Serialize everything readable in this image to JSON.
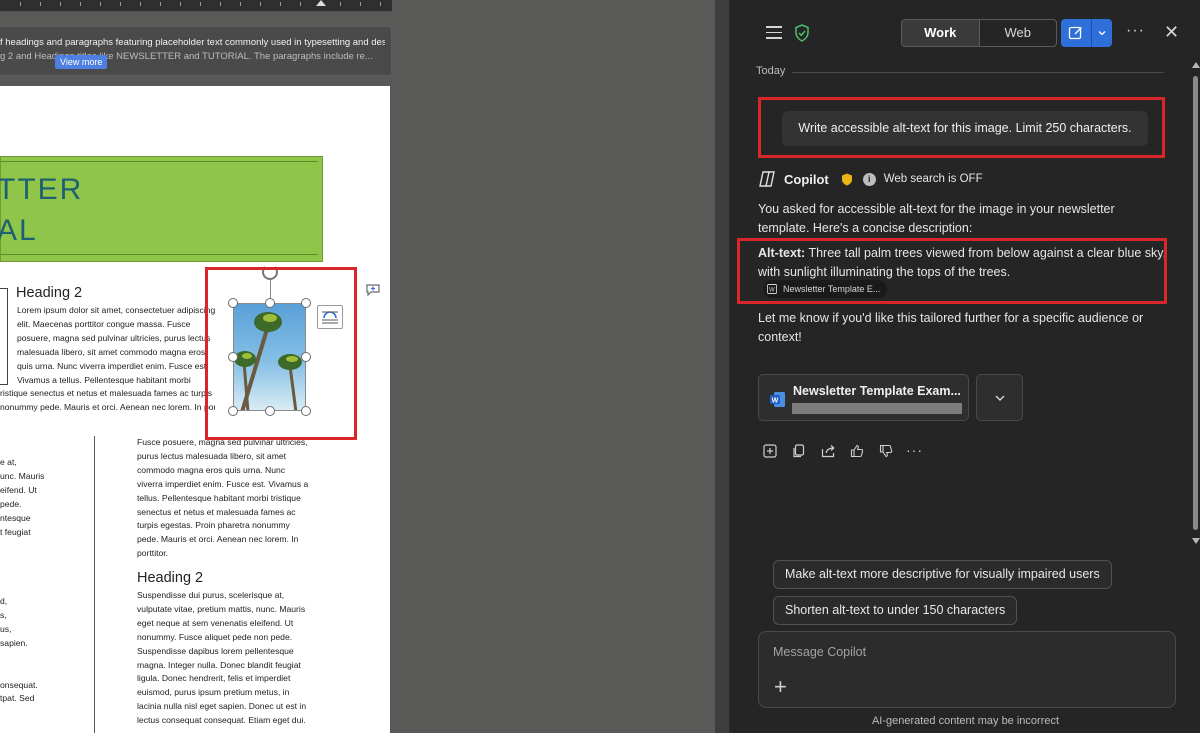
{
  "document": {
    "summary_line1": "f headings and paragraphs featuring placeholder text commonly used in typesetting and design,",
    "summary_line2": "g 2 and Headings titles like NEWSLETTER and TUTORIAL. The paragraphs include re...",
    "view_more": "View more",
    "banner_line1": "TTER",
    "banner_line2": "AL",
    "heading_a": "Heading 2",
    "heading_b": "Heading 2",
    "para_a": [
      "Lorem ipsum dolor sit amet, consectetuer adipiscing",
      "elit.  Maecenas porttitor congue massa. Fusce",
      "posuere, magna sed pulvinar ultricies, purus lectus",
      "malesuada libero, sit amet commodo magna eros",
      "quis urna. Nunc viverra imperdiet enim. Fusce est.",
      "Vivamus a tellus. Pellentesque habitant morbi",
      "ristique senectus et netus et malesuada fames ac turpis egestas. Proin pharetra",
      "nonummy pede. Mauris et orci. Aenean nec lorem. In porttitor. Donec laoreet nonummy"
    ],
    "para_left_col": [
      "e at,",
      "unc. Mauris",
      "eifend. Ut",
      "pede.",
      "ntesque",
      "t feugiat",
      "",
      "",
      "",
      "",
      "d,",
      "s,",
      "us,",
      "sapien.",
      "",
      "",
      "onsequat.",
      "tpat. Sed",
      "",
      "",
      "e,",
      "o,"
    ],
    "para_b": [
      "Fusce posuere, magna sed pulvinar ultricies,",
      "purus lectus malesuada libero, sit amet",
      "commodo magna eros quis urna. Nunc",
      "viverra imperdiet enim. Fusce est. Vivamus a",
      "tellus. Pellentesque habitant morbi tristique",
      "senectus et netus et malesuada fames ac",
      "turpis egestas. Proin pharetra nonummy",
      "pede. Mauris et orci. Aenean nec lorem. In",
      "porttitor."
    ],
    "para_c": [
      "Suspendisse dui purus, scelerisque at,",
      "vulputate vitae, pretium mattis, nunc. Mauris",
      "eget neque at sem venenatis eleifend. Ut",
      "nonummy. Fusce aliquet pede non pede.",
      "Suspendisse dapibus lorem pellentesque",
      "magna. Integer nulla. Donec blandit feugiat",
      "ligula. Donec hendrerit, felis et imperdiet",
      "euismod, purus ipsum pretium metus, in",
      "lacinia nulla nisl eget sapien. Donec ut est in",
      "lectus consequat consequat. Etiam eget dui."
    ]
  },
  "copilot": {
    "mode_work": "Work",
    "mode_web": "Web",
    "more": "···",
    "close": "✕",
    "today": "Today",
    "user_prompt": "Write accessible alt-text for this image. Limit 250 characters.",
    "name": "Copilot",
    "web_search": "Web search is OFF",
    "response_intro": "You asked for accessible alt-text for the image in your newsletter template. Here's a concise description:",
    "alt_label": "Alt-text:",
    "alt_text": " Three tall palm trees viewed from below against a clear blue sky, with sunlight illuminating the tops of the trees.",
    "ref_chip": "Newsletter Template E...",
    "response_outro": "Let me know if you'd like this tailored further for a specific audience or context!",
    "file_name": "Newsletter Template Exam...",
    "actions_more": "···",
    "suggestion_1": "Make alt-text more descriptive for visually impaired users",
    "suggestion_2": "Shorten alt-text to under 150 characters",
    "composer_placeholder": "Message Copilot",
    "composer_plus": "+",
    "disclaimer": "AI-generated content may be incorrect"
  },
  "colors": {
    "highlight_red": "#d9262b",
    "accent_blue": "#2f6fd9",
    "banner_green": "#8fc649",
    "banner_text": "#1f5f72"
  }
}
